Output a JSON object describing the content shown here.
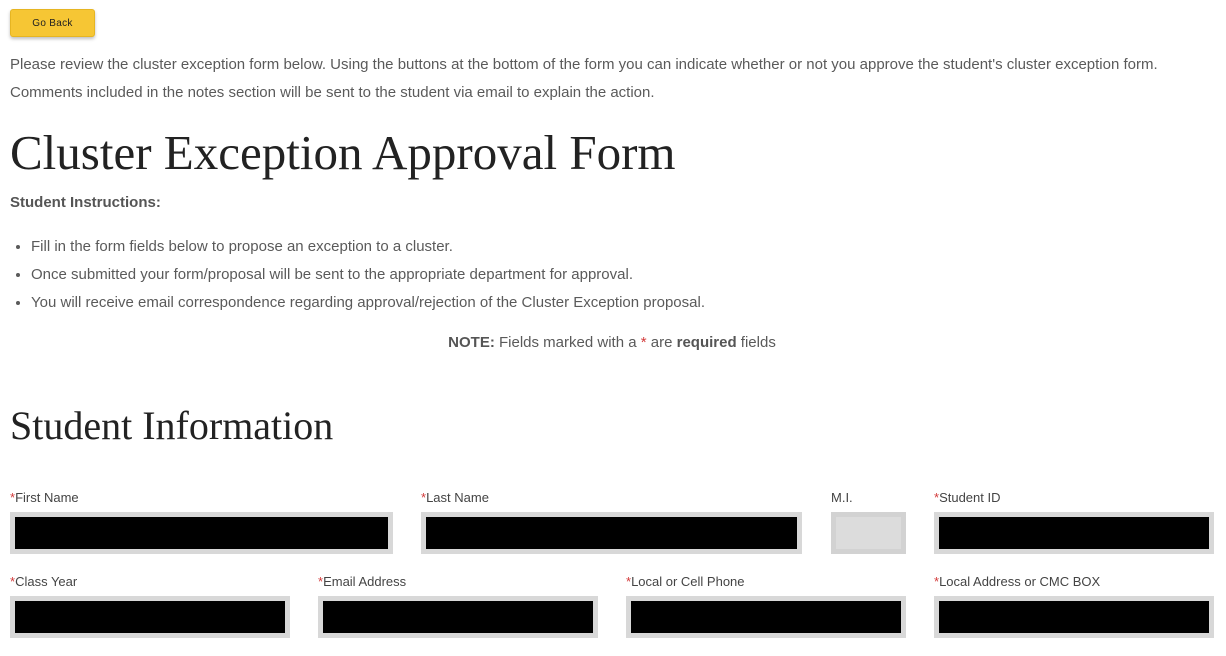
{
  "go_back": "Go Back",
  "intro": "Please review the cluster exception form below. Using the buttons at the bottom of the form you can indicate whether or not you approve the student's cluster exception form. Comments included in the notes section will be sent to the student via email to explain the action.",
  "title": "Cluster Exception Approval Form",
  "instructions": {
    "label": "Student Instructions:",
    "items": [
      "Fill in the form fields below to propose an exception to a cluster.",
      "Once submitted your form/proposal will be sent to the appropriate department for approval.",
      "You will receive email correspondence regarding approval/rejection of the Cluster Exception proposal."
    ]
  },
  "note": {
    "lead": "NOTE:",
    "text1": "Fields marked with a",
    "star": "*",
    "text2": "are",
    "bold": "required",
    "text3": "fields"
  },
  "section_title": "Student Information",
  "fields": {
    "first_name": {
      "label": "First Name",
      "required": true,
      "value": ""
    },
    "last_name": {
      "label": "Last Name",
      "required": true,
      "value": ""
    },
    "mi": {
      "label": "M.I.",
      "required": false,
      "value": ""
    },
    "student_id": {
      "label": "Student ID",
      "required": true,
      "value": ""
    },
    "class_year": {
      "label": "Class Year",
      "required": true,
      "value": ""
    },
    "email": {
      "label": "Email Address",
      "required": true,
      "value": ""
    },
    "phone": {
      "label": "Local or Cell Phone",
      "required": true,
      "value": ""
    },
    "address": {
      "label": "Local Address or CMC BOX",
      "required": true,
      "value": ""
    }
  },
  "required_marker": "*",
  "colors": {
    "button": "#f6c634",
    "required": "#d33a3a",
    "redacted": "#000000"
  }
}
